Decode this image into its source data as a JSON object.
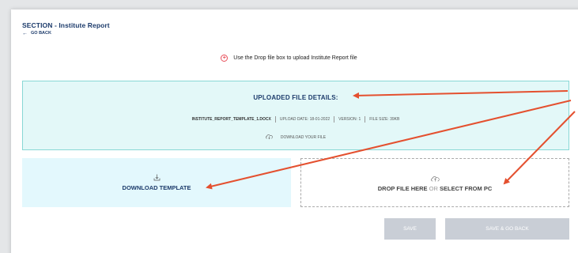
{
  "header": {
    "title": "SECTION - Institute Report",
    "back_label": "GO BACK"
  },
  "info_message": "Use the Drop file box to upload Institute Report file",
  "uploaded_file": {
    "heading": "UPLOADED FILE DETAILS:",
    "file_name": "INSTITUTE_REPORT_TEMPLATE_1.DOCX",
    "upload_date": "UPLOAD DATE: 18-01-2022",
    "version": "VERSION: 1",
    "file_size": "FILE SIZE: 39KB",
    "download_label": "DOWNLOAD YOUR FILE"
  },
  "download_template": {
    "label": "DOWNLOAD TEMPLATE"
  },
  "drop_zone": {
    "part1": "DROP FILE HERE",
    "part2": "OR",
    "part3": "SELECT FROM PC"
  },
  "buttons": {
    "save": "SAVE",
    "save_back": "SAVE & GO BACK"
  },
  "colors": {
    "primary_text": "#1c3b6b",
    "uploaded_bg": "#e3f8f8",
    "uploaded_border": "#88d8d5",
    "template_bg": "#e3f8fd",
    "button_disabled": "#c9ced6",
    "annotation_arrow": "#e4502f",
    "info_icon": "#e8505b"
  }
}
